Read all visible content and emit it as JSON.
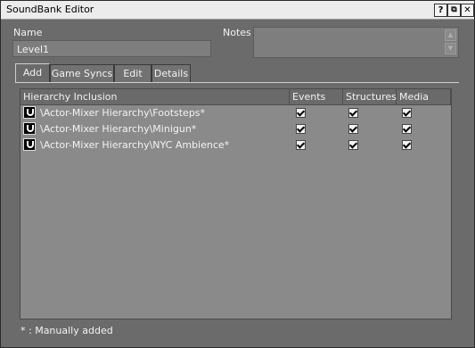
{
  "window": {
    "title": "SoundBank Editor",
    "buttons": {
      "help": "?",
      "float": "⧉",
      "close": "✕"
    }
  },
  "name": {
    "label": "Name",
    "value": "Level1"
  },
  "notes": {
    "label": "Notes",
    "value": ""
  },
  "tabs": [
    {
      "label": "Add",
      "active": true
    },
    {
      "label": "Game Syncs",
      "active": false
    },
    {
      "label": "Edit",
      "active": false
    },
    {
      "label": "Details",
      "active": false
    }
  ],
  "table": {
    "headers": {
      "inclusion": "Hierarchy Inclusion",
      "events": "Events",
      "structures": "Structures",
      "media": "Media"
    },
    "rows": [
      {
        "path": "\\Actor-Mixer Hierarchy\\Footsteps*",
        "events": true,
        "structures": true,
        "media": true
      },
      {
        "path": "\\Actor-Mixer Hierarchy\\Minigun*",
        "events": true,
        "structures": true,
        "media": true
      },
      {
        "path": "\\Actor-Mixer Hierarchy\\NYC Ambience*",
        "events": true,
        "structures": true,
        "media": true
      }
    ]
  },
  "footer": "* : Manually added"
}
